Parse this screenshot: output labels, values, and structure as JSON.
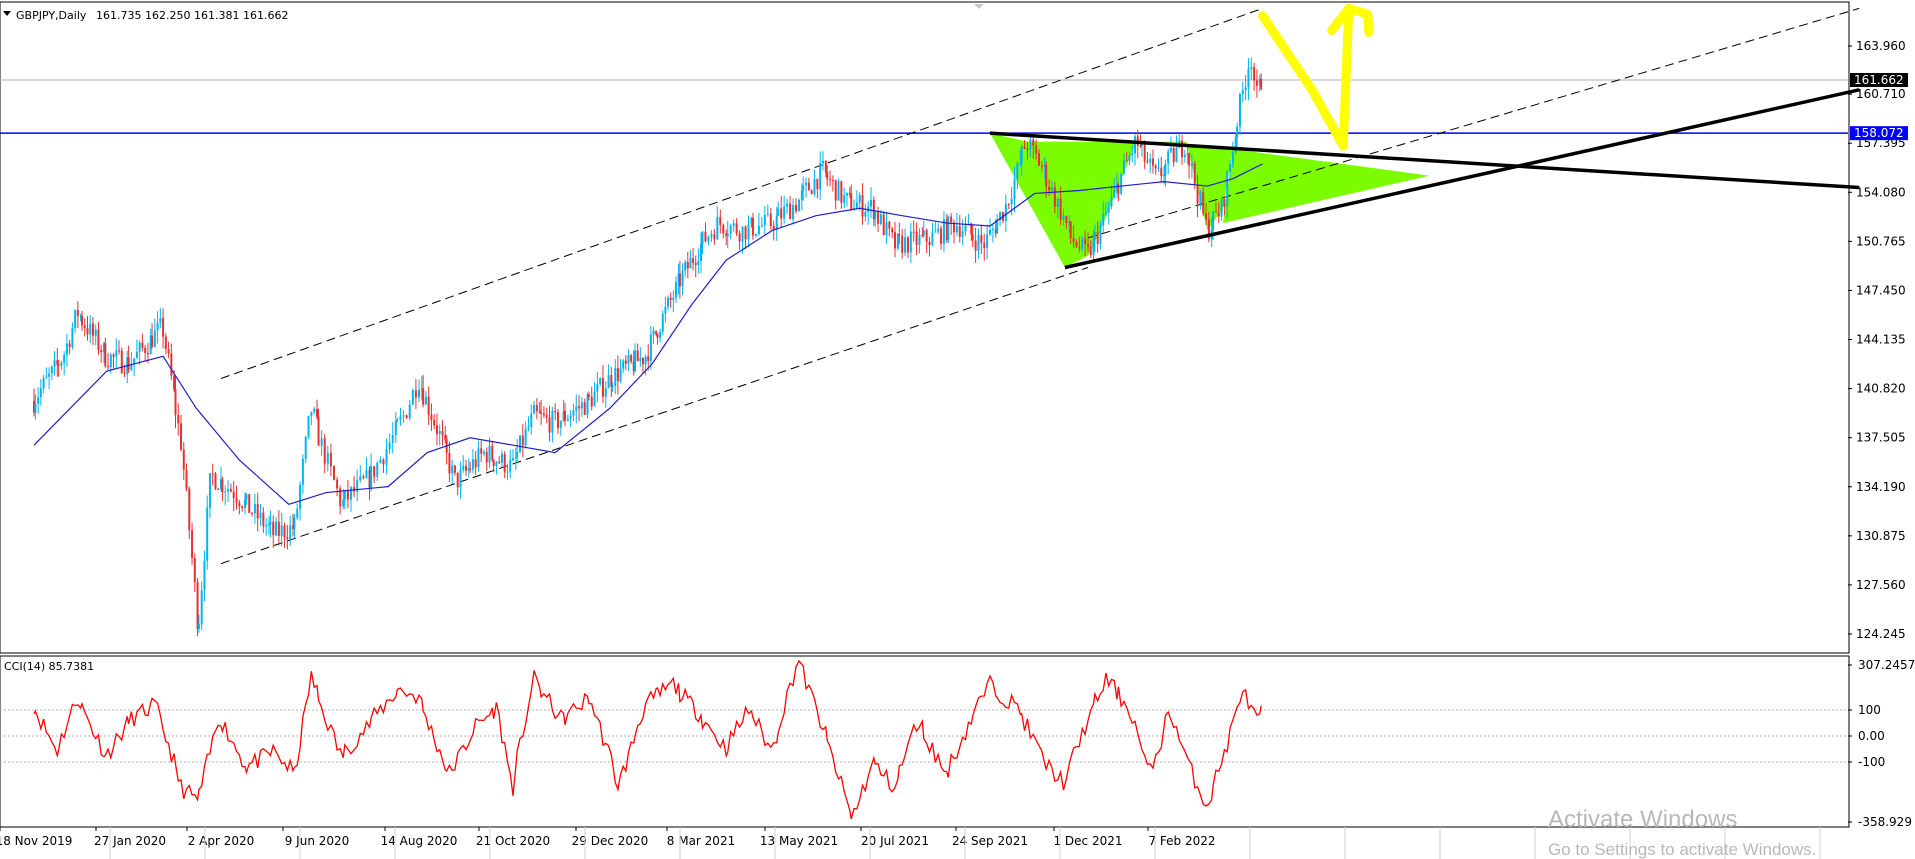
{
  "main_header": {
    "symbol": "GBPJPY,Daily",
    "ohlc": "161.735 162.250 161.381 161.662"
  },
  "indicator_header": {
    "text": "CCI(14) 85.7381"
  },
  "watermark": {
    "line1": "Activate Windows",
    "line2": "Go to Settings to activate Windows."
  },
  "colors": {
    "candle_up": "#00b4f0",
    "candle_down": "#e83030",
    "ma": "#2020c8",
    "cci": "#ff0000",
    "support_line": "#0000ff",
    "triangle_fill": "#7cfc00",
    "arrow": "#ffff00",
    "price_tag_bg": "#000000",
    "support_tag_bg": "#0000ff"
  },
  "chart_data": [
    {
      "type": "candlestick",
      "title": "GBPJPY,Daily",
      "ylim": [
        122.5,
        167.0
      ],
      "y_ticks": [
        "163.960",
        "160.710",
        "157.395",
        "154.080",
        "150.765",
        "147.450",
        "144.135",
        "140.820",
        "137.505",
        "134.190",
        "130.875",
        "127.560",
        "124.245"
      ],
      "x_ticks": [
        "18 Nov 2019",
        "27 Jan 2020",
        "2 Apr 2020",
        "9 Jun 2020",
        "14 Aug 2020",
        "21 Oct 2020",
        "29 Dec 2020",
        "8 Mar 2021",
        "13 May 2021",
        "20 Jul 2021",
        "24 Sep 2021",
        "1 Dec 2021",
        "7 Feb 2022"
      ],
      "current_price": "161.662",
      "support_level": "158.072",
      "price_path": [
        [
          "2019-11-18",
          140.0
        ],
        [
          "2019-12-10",
          143.0
        ],
        [
          "2019-12-20",
          146.0
        ],
        [
          "2020-01-10",
          143.0
        ],
        [
          "2020-01-27",
          142.5
        ],
        [
          "2020-02-20",
          145.0
        ],
        [
          "2020-03-05",
          137.0
        ],
        [
          "2020-03-17",
          124.3
        ],
        [
          "2020-03-26",
          135.0
        ],
        [
          "2020-04-10",
          134.0
        ],
        [
          "2020-05-10",
          131.0
        ],
        [
          "2020-05-25",
          131.5
        ],
        [
          "2020-06-05",
          139.5
        ],
        [
          "2020-06-25",
          133.0
        ],
        [
          "2020-07-15",
          135.0
        ],
        [
          "2020-08-05",
          139.0
        ],
        [
          "2020-08-14",
          141.5
        ],
        [
          "2020-08-28",
          138.0
        ],
        [
          "2020-09-10",
          134.5
        ],
        [
          "2020-10-01",
          136.5
        ],
        [
          "2020-10-21",
          135.5
        ],
        [
          "2020-11-05",
          139.0
        ],
        [
          "2020-11-20",
          138.5
        ],
        [
          "2020-12-15",
          140.0
        ],
        [
          "2020-12-29",
          141.5
        ],
        [
          "2021-01-25",
          143.0
        ],
        [
          "2021-02-20",
          148.0
        ],
        [
          "2021-03-08",
          150.5
        ],
        [
          "2021-03-20",
          152.0
        ],
        [
          "2021-04-05",
          151.5
        ],
        [
          "2021-04-25",
          152.0
        ],
        [
          "2021-05-13",
          153.5
        ],
        [
          "2021-05-30",
          155.5
        ],
        [
          "2021-06-15",
          153.5
        ],
        [
          "2021-07-05",
          153.0
        ],
        [
          "2021-07-20",
          150.5
        ],
        [
          "2021-08-15",
          151.0
        ],
        [
          "2021-09-01",
          152.0
        ],
        [
          "2021-09-20",
          150.5
        ],
        [
          "2021-10-05",
          153.0
        ],
        [
          "2021-10-20",
          157.5
        ],
        [
          "2021-11-01",
          155.5
        ],
        [
          "2021-11-20",
          151.0
        ],
        [
          "2021-12-01",
          149.8
        ],
        [
          "2021-12-10",
          151.5
        ],
        [
          "2021-12-25",
          155.0
        ],
        [
          "2022-01-05",
          157.5
        ],
        [
          "2022-01-20",
          155.0
        ],
        [
          "2022-02-01",
          156.5
        ],
        [
          "2022-02-10",
          157.5
        ],
        [
          "2022-02-25",
          151.5
        ],
        [
          "2022-03-08",
          153.0
        ],
        [
          "2022-03-15",
          157.0
        ],
        [
          "2022-03-22",
          160.5
        ],
        [
          "2022-03-28",
          163.5
        ],
        [
          "2022-04-01",
          160.5
        ],
        [
          "2022-04-05",
          161.662
        ]
      ],
      "moving_average": [
        [
          "2019-11-18",
          137.0
        ],
        [
          "2020-01-10",
          142.0
        ],
        [
          "2020-02-20",
          143.0
        ],
        [
          "2020-03-15",
          139.5
        ],
        [
          "2020-04-15",
          136.0
        ],
        [
          "2020-05-20",
          133.0
        ],
        [
          "2020-06-15",
          133.8
        ],
        [
          "2020-07-25",
          134.2
        ],
        [
          "2020-08-20",
          136.5
        ],
        [
          "2020-09-20",
          137.5
        ],
        [
          "2020-10-21",
          137.0
        ],
        [
          "2020-11-20",
          136.5
        ],
        [
          "2020-12-29",
          139.5
        ],
        [
          "2021-01-30",
          142.5
        ],
        [
          "2021-03-01",
          146.5
        ],
        [
          "2021-03-25",
          149.5
        ],
        [
          "2021-04-25",
          151.5
        ],
        [
          "2021-05-25",
          152.5
        ],
        [
          "2021-06-25",
          153.0
        ],
        [
          "2021-07-25",
          152.5
        ],
        [
          "2021-08-25",
          152.0
        ],
        [
          "2021-09-24",
          151.8
        ],
        [
          "2021-10-25",
          154.0
        ],
        [
          "2021-11-25",
          154.2
        ],
        [
          "2021-12-25",
          154.5
        ],
        [
          "2022-01-25",
          154.8
        ],
        [
          "2022-02-25",
          154.5
        ],
        [
          "2022-03-15",
          155.0
        ],
        [
          "2022-04-05",
          156.0
        ]
      ],
      "channel": {
        "lower": [
          [
            "2020-04-02",
            129.0
          ],
          [
            "2021-12-01",
            149.0
          ]
        ],
        "upper": [
          [
            "2020-04-02",
            141.5
          ],
          [
            "2022-04-05",
            166.5
          ]
        ],
        "upper_parallel": [
          [
            "2021-12-01",
            151.0
          ],
          [
            "2023-06-01",
            166.5
          ]
        ]
      },
      "triangle": {
        "resistance": [
          [
            "2021-09-24",
            158.072
          ],
          [
            "2023-06-01",
            154.4
          ]
        ],
        "support": [
          [
            "2021-11-15",
            149.0
          ],
          [
            "2023-06-01",
            161.0
          ]
        ]
      },
      "pattern_highlights": [
        [
          [
            "2021-09-24",
            158.072
          ],
          [
            "2021-10-20",
            157.5
          ],
          [
            "2021-12-01",
            149.8
          ],
          [
            "2021-11-15",
            149.0
          ]
        ],
        [
          [
            "2021-10-20",
            157.5
          ],
          [
            "2021-12-01",
            149.8
          ],
          [
            "2021-12-10",
            151.5
          ],
          [
            "2022-01-05",
            157.5
          ]
        ],
        [
          [
            "2022-01-05",
            157.5
          ],
          [
            "2022-02-10",
            157.5
          ],
          [
            "2022-02-25",
            151.5
          ],
          [
            "2022-03-08",
            153.0
          ],
          [
            "2022-03-15",
            157.0
          ]
        ],
        [
          [
            "2022-03-15",
            157.0
          ],
          [
            "2022-08-01",
            155.2
          ],
          [
            "2022-03-08",
            152.0
          ]
        ]
      ],
      "projection_arrow": [
        [
          "2022-04-05",
          166.0
        ],
        [
          "2022-05-10",
          161.0
        ],
        [
          "2022-06-01",
          157.2
        ],
        [
          "2022-06-05",
          166.5
        ]
      ]
    },
    {
      "type": "line",
      "title": "CCI(14) 85.7381",
      "ylim": [
        -358.9,
        307.2457
      ],
      "y_ticks": [
        "307.2457",
        "100",
        "0.00",
        "-100",
        "-358.929"
      ],
      "levels": [
        100,
        0,
        -100
      ],
      "series": [
        {
          "values": [
            [
              "2019-11-18",
              120
            ],
            [
              "2019-12-05",
              -60
            ],
            [
              "2019-12-20",
              150
            ],
            [
              "2020-01-10",
              -80
            ],
            [
              "2020-01-27",
              60
            ],
            [
              "2020-02-15",
              120
            ],
            [
              "2020-03-05",
              -200
            ],
            [
              "2020-03-17",
              -250
            ],
            [
              "2020-04-01",
              80
            ],
            [
              "2020-04-20",
              -120
            ],
            [
              "2020-05-10",
              -60
            ],
            [
              "2020-05-25",
              -150
            ],
            [
              "2020-06-05",
              230
            ],
            [
              "2020-06-25",
              -80
            ],
            [
              "2020-07-15",
              60
            ],
            [
              "2020-08-01",
              180
            ],
            [
              "2020-08-14",
              150
            ],
            [
              "2020-09-05",
              -150
            ],
            [
              "2020-09-25",
              40
            ],
            [
              "2020-10-10",
              110
            ],
            [
              "2020-10-21",
              -200
            ],
            [
              "2020-11-05",
              220
            ],
            [
              "2020-11-25",
              60
            ],
            [
              "2020-12-15",
              150
            ],
            [
              "2021-01-05",
              -190
            ],
            [
              "2021-01-25",
              120
            ],
            [
              "2021-02-15",
              200
            ],
            [
              "2021-03-08",
              80
            ],
            [
              "2021-03-25",
              -50
            ],
            [
              "2021-04-10",
              110
            ],
            [
              "2021-04-25",
              -60
            ],
            [
              "2021-05-13",
              300
            ],
            [
              "2021-06-05",
              -60
            ],
            [
              "2021-06-20",
              -320
            ],
            [
              "2021-07-05",
              -100
            ],
            [
              "2021-07-20",
              -200
            ],
            [
              "2021-08-05",
              60
            ],
            [
              "2021-08-25",
              -150
            ],
            [
              "2021-09-10",
              50
            ],
            [
              "2021-09-24",
              200
            ],
            [
              "2021-10-15",
              100
            ],
            [
              "2021-11-01",
              -100
            ],
            [
              "2021-11-15",
              -180
            ],
            [
              "2021-12-01",
              60
            ],
            [
              "2021-12-15",
              220
            ],
            [
              "2022-01-01",
              100
            ],
            [
              "2022-01-15",
              -150
            ],
            [
              "2022-01-30",
              100
            ],
            [
              "2022-02-10",
              -80
            ],
            [
              "2022-02-25",
              -270
            ],
            [
              "2022-03-10",
              -60
            ],
            [
              "2022-03-22",
              180
            ],
            [
              "2022-04-01",
              60
            ],
            [
              "2022-04-05",
              85.7381
            ]
          ]
        }
      ]
    }
  ]
}
